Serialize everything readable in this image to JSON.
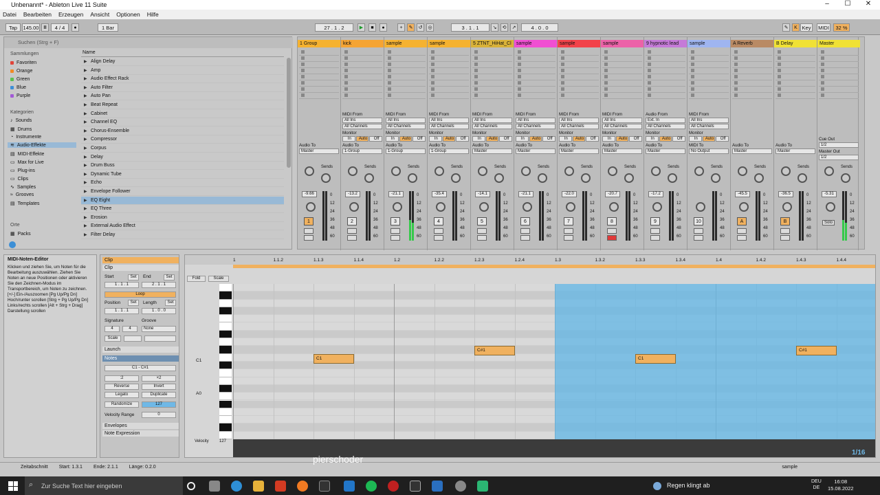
{
  "window": {
    "title": "Unbenannt* - Ableton Live 11 Suite",
    "controls": [
      "–",
      "☐",
      "✕"
    ]
  },
  "menu": [
    "Datei",
    "Bearbeiten",
    "Erzeugen",
    "Ansicht",
    "Optionen",
    "Hilfe"
  ],
  "transport": {
    "tap": "Tap",
    "tempo": "145.00",
    "signature": "4 / 4",
    "quantize": "1 Bar",
    "position": "27 . 1 . 2",
    "loop_start": "3 . 1 . 1",
    "loop_length": "4 . 0 . 0",
    "key": "Key",
    "midi": "MIDI",
    "cpu": "32 %"
  },
  "browser": {
    "search_placeholder": "Suchen (Strg + F)",
    "column_name": "Name",
    "collections_title": "Sammlungen",
    "collections": [
      {
        "label": "Favoriten",
        "color": "#e0453a"
      },
      {
        "label": "Orange",
        "color": "#f08a24"
      },
      {
        "label": "Green",
        "color": "#5bbf4f"
      },
      {
        "label": "Blue",
        "color": "#3d8fd6"
      },
      {
        "label": "Purple",
        "color": "#a25ad6"
      }
    ],
    "categories_title": "Kategorien",
    "categories": [
      "Sounds",
      "Drums",
      "Instrumente",
      "Audio-Effekte",
      "MIDI-Effekte",
      "Max for Live",
      "Plug-ins",
      "Clips",
      "Samples",
      "Grooves",
      "Templates"
    ],
    "places_title": "Orte",
    "places": [
      "Packs"
    ],
    "items": [
      "Align Delay",
      "Amp",
      "Audio Effect Rack",
      "Auto Filter",
      "Auto Pan",
      "Beat Repeat",
      "Cabinet",
      "Channel EQ",
      "Chorus-Ensemble",
      "Compressor",
      "Corpus",
      "Delay",
      "Drum Buss",
      "Dynamic Tube",
      "Echo",
      "Envelope Follower",
      "EQ Eight",
      "EQ Three",
      "Erosion",
      "External Audio Effect",
      "Filter Delay"
    ],
    "selected_item": "EQ Eight"
  },
  "tracks": [
    {
      "name": "1 Group",
      "color": "#f5b230",
      "vol": "-9.66",
      "num": "1",
      "route": "Master",
      "midi_from": ""
    },
    {
      "name": "kick",
      "color": "#f5a433",
      "vol": "-13.2",
      "num": "2",
      "route": "1-Group",
      "midi_from": "All Ins"
    },
    {
      "name": "sample",
      "color": "#f5b230",
      "vol": "-21.1",
      "num": "3",
      "route": "1-Group",
      "midi_from": "All Ins"
    },
    {
      "name": "sample",
      "color": "#f5b230",
      "vol": "-35.4",
      "num": "4",
      "route": "1-Group",
      "midi_from": "All Ins"
    },
    {
      "name": "5 ZTNT_HiHat_Cl",
      "color": "#d9b239",
      "vol": "-14.1",
      "num": "5",
      "route": "Master",
      "midi_from": "All Ins"
    },
    {
      "name": "sample",
      "color": "#f04fd2",
      "vol": "-21.1",
      "num": "6",
      "route": "Master",
      "midi_from": "All Ins"
    },
    {
      "name": "sample",
      "color": "#f2424a",
      "vol": "-22.0",
      "num": "7",
      "route": "Master",
      "midi_from": "All Ins"
    },
    {
      "name": "sample",
      "color": "#ec62a8",
      "vol": "-20.7",
      "num": "8",
      "route": "Master",
      "midi_from": "All Ins"
    },
    {
      "name": "9 hypnotic lead",
      "color": "#c57ad8",
      "vol": "-17.2",
      "num": "9",
      "route": "Master",
      "midi_from": "Ext. In"
    },
    {
      "name": "sample",
      "color": "#9fb5f0",
      "vol": "",
      "num": "10",
      "route": "No Output",
      "midi_from": "All Ins"
    },
    {
      "name": "A Reverb",
      "color": "#b98a64",
      "vol": "-45.5",
      "num": "A",
      "route": "Master",
      "midi_from": ""
    },
    {
      "name": "B Delay",
      "color": "#f0e135",
      "vol": "-36.5",
      "num": "B",
      "route": "Master",
      "midi_from": ""
    },
    {
      "name": "Master",
      "color": "#f0e135",
      "vol": "-5.31",
      "num": "",
      "route": "1/2",
      "midi_from": ""
    }
  ],
  "mixer_labels": {
    "midi_from": "MIDI From",
    "all_channels": "All Channels",
    "monitor": "Monitor",
    "in": "In",
    "auto": "Auto",
    "off": "Off",
    "audio_to": "Audio To",
    "midi_to": "MIDI To",
    "sends": "Sends",
    "cue_out": "Cue Out",
    "master_out": "Master Out",
    "post": "Post",
    "solo": "Solo",
    "audio_from": "Audio From"
  },
  "meter_scale": [
    "0",
    "12",
    "24",
    "36",
    "48",
    "60"
  ],
  "info": {
    "title": "MIDI-Noten-Editor",
    "text": "Klicken und ziehen Sie, um Noten für die Bearbeitung auszuwählen. Ziehen Sie Noten an neue Positionen oder aktivieren Sie den Zeichnen-Modus im Transportbereich, um Noten zu zeichnen. [+/-] Ein-/Auszoomen [Pg Up/Pg Dn] Hoch/runter scrollen [Strg + Pg Up/Pg Dn] Links/rechts scrollen [Alt + Strg + Drag] Darstellung scrollen"
  },
  "clip": {
    "header": "Clip",
    "sub": "Clip",
    "start": "Start",
    "set": "Set",
    "end": "End",
    "start_val": "1 . 1 . 1",
    "end_val": "2 . 1 . 1",
    "loop": "Loop",
    "position": "Position",
    "length": "Length",
    "pos_val": "1 . 1 . 1",
    "len_val": "1 . 0 . 0",
    "signature": "Signature",
    "groove": "Groove",
    "sig_num": "4",
    "sig_den": "4",
    "groove_val": "None",
    "scale": "Scale",
    "launch": "Launch",
    "notes": "Notes",
    "range": "C1 - C#1",
    "x2": ":2",
    "times2": "×2",
    "reverse": "Reverse",
    "invert": "Invert",
    "legato": "Legato",
    "duplicate": "Duplicate",
    "randomize": "Randomize",
    "rand_val": "127",
    "vel_range": "Velocity Range",
    "vel_val": "0",
    "envelopes": "Envelopes",
    "note_expr": "Note Expression"
  },
  "editor": {
    "fold": "Fold",
    "scale": "Scale",
    "ruler": [
      "1",
      "1.1.2",
      "1.1.3",
      "1.1.4",
      "1.2",
      "1.2.2",
      "1.2.3",
      "1.2.4",
      "1.3",
      "1.3.2",
      "1.3.3",
      "1.3.4",
      "1.4",
      "1.4.2",
      "1.4.3",
      "1.4.4"
    ],
    "key_c1": "C1",
    "key_a0": "A0",
    "velocity": "Velocity",
    "vel_max": "127",
    "vel_min": "1",
    "page": "1/16",
    "notes": [
      {
        "label": "C1",
        "start": 0.5,
        "len": 0.25,
        "row": "C1"
      },
      {
        "label": "C#1",
        "start": 1.5,
        "len": 0.25,
        "row": "C#1"
      },
      {
        "label": "C1",
        "start": 2.5,
        "len": 0.25,
        "row": "C1"
      },
      {
        "label": "C#1",
        "start": 3.5,
        "len": 0.25,
        "row": "C#1"
      }
    ]
  },
  "status": {
    "section": "Zeitabschnitt",
    "start": "Start: 1.3.1",
    "end": "Ende: 2.1.1",
    "length": "Länge: 0.2.0",
    "track": "sample"
  },
  "watermark": "pierschoder",
  "taskbar": {
    "search": "Zur Suche Text hier eingeben",
    "weather": "Regen klingt ab",
    "time": "16:08",
    "date": "15.08.2022",
    "lang": "DEU",
    "region": "DE"
  }
}
